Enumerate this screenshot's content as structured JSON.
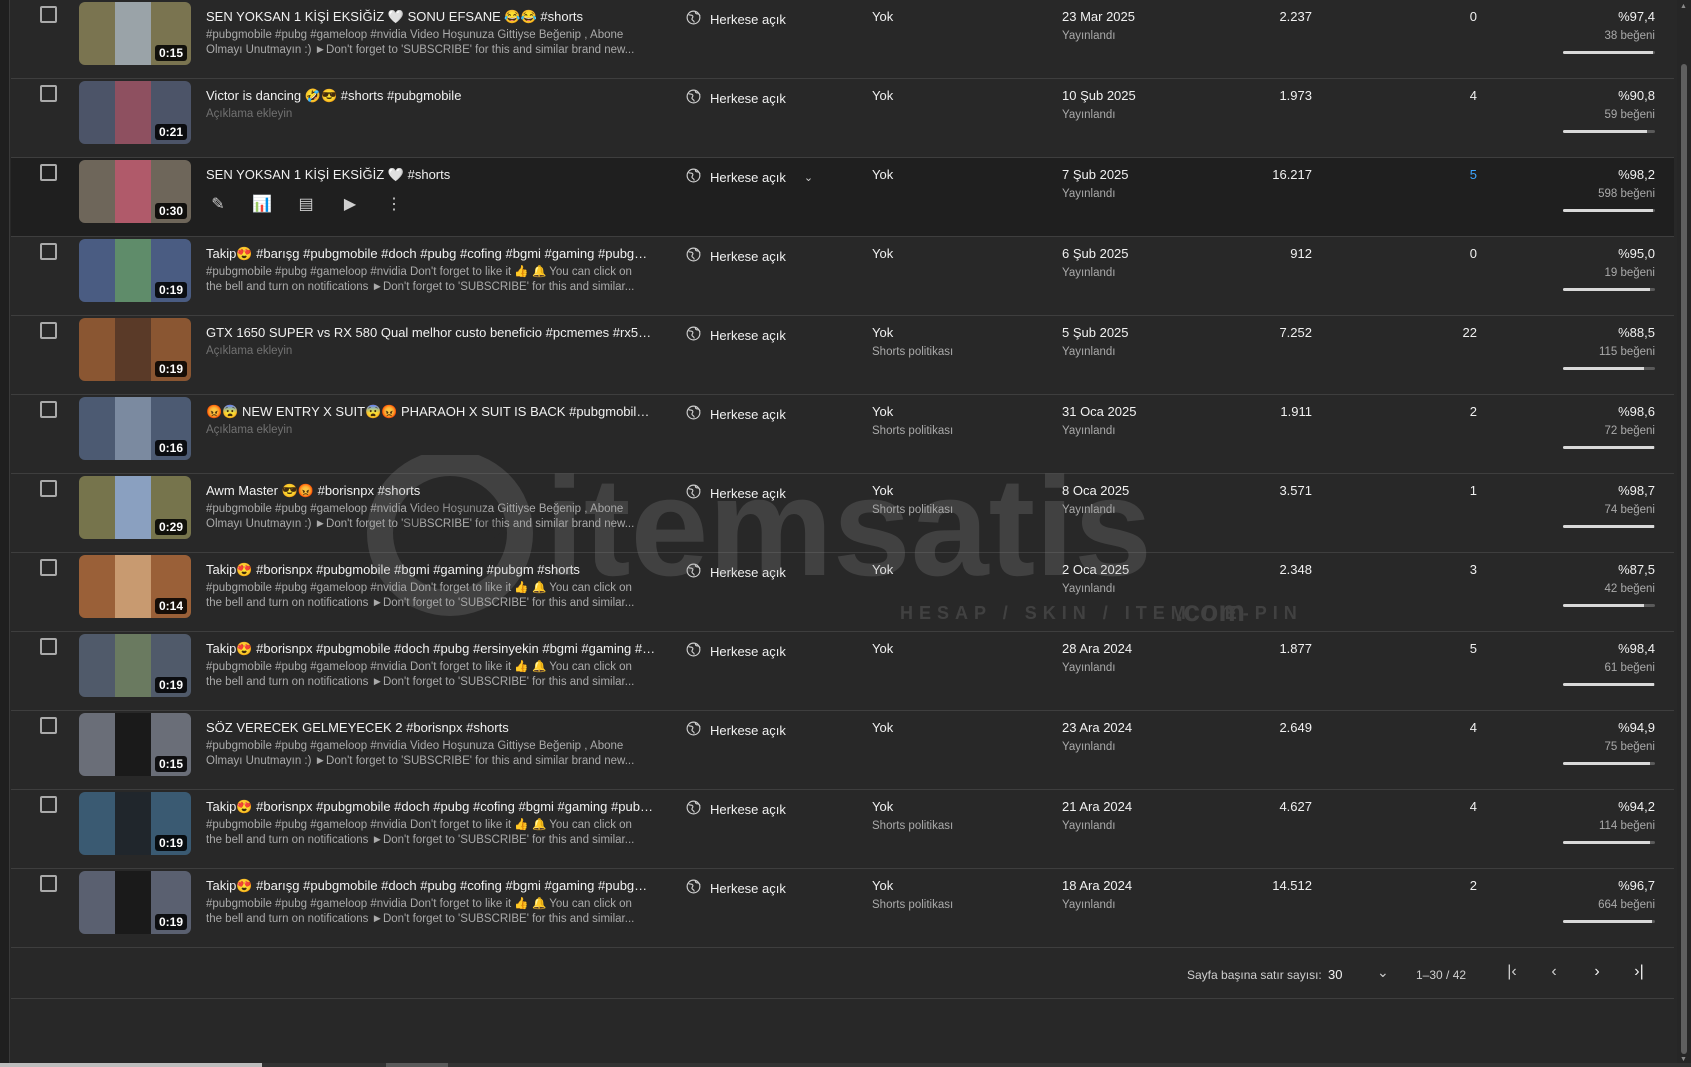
{
  "colors": {
    "background": "#282828",
    "hover_row": "#1f1f1f",
    "link": "#3ea6ff",
    "secondary_text": "#aaaaaa"
  },
  "rows": [
    {
      "title": "SEN YOKSAN 1 KİŞİ EKSİĞİZ 🤍 SONU EFSANE 😂😂 #shorts",
      "desc": "#pubgmobile #pubg #gameloop #nvidia Video Hoşunuza Gittiyse Beğenip , Abone Olmayı Unutmayın :) ►Don't forget to 'SUBSCRIBE' for this and similar brand new...",
      "duration": "0:15",
      "visibility": "Herkese açık",
      "restriction": "Yok",
      "restriction_sub": "",
      "date": "23 Mar 2025",
      "date_sub": "Yayınlandı",
      "views": "2.237",
      "comments": "0",
      "likes": "%97,4",
      "likes_sub": "38 beğeni",
      "like_ratio": 0.974,
      "thumb_left": "#7a7450",
      "thumb_center": "#9aa3a8"
    },
    {
      "title": "Victor is dancing 🤣😎 #shorts #pubgmobile",
      "desc": "Açıklama ekleyin",
      "duration": "0:21",
      "visibility": "Herkese açık",
      "restriction": "Yok",
      "restriction_sub": "",
      "date": "10 Şub 2025",
      "date_sub": "Yayınlandı",
      "views": "1.973",
      "comments": "4",
      "likes": "%90,8",
      "likes_sub": "59 beğeni",
      "like_ratio": 0.908,
      "thumb_left": "#4c5468",
      "thumb_center": "#8e5060"
    },
    {
      "title": "SEN YOKSAN 1 KİŞİ EKSİĞİZ 🤍 #shorts",
      "desc": "",
      "duration": "0:30",
      "visibility": "Herkese açık",
      "restriction": "Yok",
      "restriction_sub": "",
      "date": "7 Şub 2025",
      "date_sub": "Yayınlandı",
      "views": "16.217",
      "comments": "5",
      "likes": "%98,2",
      "likes_sub": "598 beğeni",
      "like_ratio": 0.982,
      "thumb_left": "#6e665a",
      "thumb_center": "#b05a6a"
    },
    {
      "title": "Takip😍 #barışg #pubgmobile #doch #pubg #cofing #bgmi #gaming #pubgm #...",
      "desc": "#pubgmobile #pubg #gameloop #nvidia Don't forget to like it 👍 🔔 You can click on the bell and turn on notifications ►Don't forget to 'SUBSCRIBE' for this and similar...",
      "duration": "0:19",
      "visibility": "Herkese açık",
      "restriction": "Yok",
      "restriction_sub": "",
      "date": "6 Şub 2025",
      "date_sub": "Yayınlandı",
      "views": "912",
      "comments": "0",
      "likes": "%95,0",
      "likes_sub": "19 beğeni",
      "like_ratio": 0.95,
      "thumb_left": "#4a5c82",
      "thumb_center": "#5f8c6a"
    },
    {
      "title": "GTX 1650 SUPER vs RX 580 Qual melhor custo beneficio #pcmemes #rx580 #gt...",
      "desc": "Açıklama ekleyin",
      "duration": "0:19",
      "visibility": "Herkese açık",
      "restriction": "Yok",
      "restriction_sub": "Shorts politikası",
      "date": "5 Şub 2025",
      "date_sub": "Yayınlandı",
      "views": "7.252",
      "comments": "22",
      "likes": "%88,5",
      "likes_sub": "115 beğeni",
      "like_ratio": 0.885,
      "thumb_left": "#8a5632",
      "thumb_center": "#5a3a28"
    },
    {
      "title": "😡😨 NEW ENTRY X SUIT😨😡 PHARAOH X SUIT IS BACK #pubgmobile #pub...",
      "desc": "Açıklama ekleyin",
      "duration": "0:16",
      "visibility": "Herkese açık",
      "restriction": "Yok",
      "restriction_sub": "Shorts politikası",
      "date": "31 Oca 2025",
      "date_sub": "Yayınlandı",
      "views": "1.911",
      "comments": "2",
      "likes": "%98,6",
      "likes_sub": "72 beğeni",
      "like_ratio": 0.986,
      "thumb_left": "#4c5a72",
      "thumb_center": "#7b8aa0"
    },
    {
      "title": "Awm Master 😎😡 #borisnpx #shorts",
      "desc": "#pubgmobile #pubg #gameloop #nvidia Video Hoşunuza Gittiyse Beğenip , Abone Olmayı Unutmayın :) ►Don't forget to 'SUBSCRIBE' for this and similar brand new...",
      "duration": "0:29",
      "visibility": "Herkese açık",
      "restriction": "Yok",
      "restriction_sub": "Shorts politikası",
      "date": "8 Oca 2025",
      "date_sub": "Yayınlandı",
      "views": "3.571",
      "comments": "1",
      "likes": "%98,7",
      "likes_sub": "74 beğeni",
      "like_ratio": 0.987,
      "thumb_left": "#76744c",
      "thumb_center": "#8aa0c0"
    },
    {
      "title": "Takip😍 #borisnpx #pubgmobile #bgmi #gaming #pubgm #shorts",
      "desc": "#pubgmobile #pubg #gameloop #nvidia Don't forget to like it 👍 🔔 You can click on the bell and turn on notifications ►Don't forget to 'SUBSCRIBE' for this and similar...",
      "duration": "0:14",
      "visibility": "Herkese açık",
      "restriction": "Yok",
      "restriction_sub": "",
      "date": "2 Oca 2025",
      "date_sub": "Yayınlandı",
      "views": "2.348",
      "comments": "3",
      "likes": "%87,5",
      "likes_sub": "42 beğeni",
      "like_ratio": 0.875,
      "thumb_left": "#9a6038",
      "thumb_center": "#c89a70"
    },
    {
      "title": "Takip😍 #borisnpx #pubgmobile #doch #pubg #ersinyekin #bgmi #gaming #pu...",
      "desc": "#pubgmobile #pubg #gameloop #nvidia Don't forget to like it 👍 🔔 You can click on the bell and turn on notifications ►Don't forget to 'SUBSCRIBE' for this and similar...",
      "duration": "0:19",
      "visibility": "Herkese açık",
      "restriction": "Yok",
      "restriction_sub": "",
      "date": "28 Ara 2024",
      "date_sub": "Yayınlandı",
      "views": "1.877",
      "comments": "5",
      "likes": "%98,4",
      "likes_sub": "61 beğeni",
      "like_ratio": 0.984,
      "thumb_left": "#505a6a",
      "thumb_center": "#6a7a60"
    },
    {
      "title": "SÖZ VERECEK GELMEYECEK 2 #borisnpx #shorts",
      "desc": "#pubgmobile #pubg #gameloop #nvidia Video Hoşunuza Gittiyse Beğenip , Abone Olmayı Unutmayın :) ►Don't forget to 'SUBSCRIBE' for this and similar brand new...",
      "duration": "0:15",
      "visibility": "Herkese açık",
      "restriction": "Yok",
      "restriction_sub": "",
      "date": "23 Ara 2024",
      "date_sub": "Yayınlandı",
      "views": "2.649",
      "comments": "4",
      "likes": "%94,9",
      "likes_sub": "75 beğeni",
      "like_ratio": 0.949,
      "thumb_left": "#6a6e78",
      "thumb_center": "#1a1a1a"
    },
    {
      "title": "Takip😍 #borisnpx #pubgmobile #doch #pubg #cofing #bgmi #gaming #pubg...",
      "desc": "#pubgmobile #pubg #gameloop #nvidia Don't forget to like it 👍 🔔 You can click on the bell and turn on notifications ►Don't forget to 'SUBSCRIBE' for this and similar...",
      "duration": "0:19",
      "visibility": "Herkese açık",
      "restriction": "Yok",
      "restriction_sub": "Shorts politikası",
      "date": "21 Ara 2024",
      "date_sub": "Yayınlandı",
      "views": "4.627",
      "comments": "4",
      "likes": "%94,2",
      "likes_sub": "114 beğeni",
      "like_ratio": 0.942,
      "thumb_left": "#3a5a72",
      "thumb_center": "#20262c"
    },
    {
      "title": "Takip😍 #barışg #pubgmobile #doch #pubg #cofing #bgmi #gaming #pubgm #...",
      "desc": "#pubgmobile #pubg #gameloop #nvidia Don't forget to like it 👍 🔔 You can click on the bell and turn on notifications ►Don't forget to 'SUBSCRIBE' for this and similar...",
      "duration": "0:19",
      "visibility": "Herkese açık",
      "restriction": "Yok",
      "restriction_sub": "Shorts politikası",
      "date": "18 Ara 2024",
      "date_sub": "Yayınlandı",
      "views": "14.512",
      "comments": "2",
      "likes": "%96,7",
      "likes_sub": "664 beğeni",
      "like_ratio": 0.967,
      "thumb_left": "#5a6070",
      "thumb_center": "#1a1a1a"
    }
  ],
  "hover_row_index": 2,
  "pagination": {
    "rows_per_page_label": "Sayfa başına satır sayısı:",
    "rows_per_page": "30",
    "range": "1–30 / 42"
  },
  "watermark": {
    "brand": "itemsatis",
    "tagline": "HESAP / SKIN / ITEM / E-PIN",
    "suffix": ".com"
  }
}
